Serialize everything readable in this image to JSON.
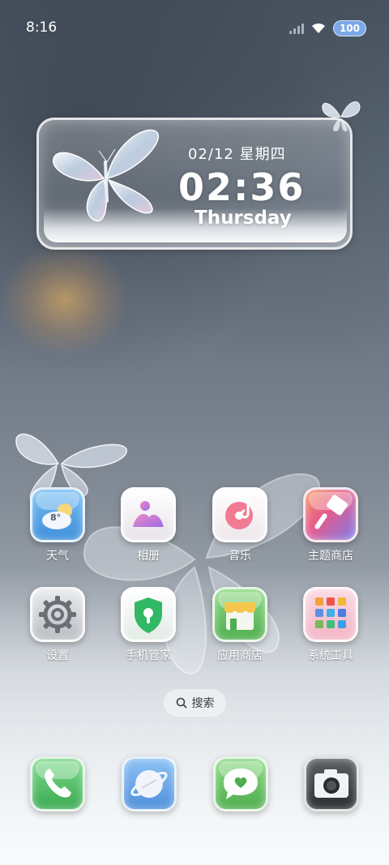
{
  "status_bar": {
    "time": "8:16",
    "battery": "100"
  },
  "widget": {
    "date": "02/12 星期四",
    "clock": "02:36",
    "day": "Thursday"
  },
  "apps": [
    {
      "label": "天气",
      "icon": "weather-icon",
      "temp": "8°",
      "color": "#5aa6e6"
    },
    {
      "label": "相册",
      "icon": "gallery-icon",
      "color": "#f4f2f6"
    },
    {
      "label": "音乐",
      "icon": "music-icon",
      "color": "#f3eef0"
    },
    {
      "label": "主题商店",
      "icon": "theme-store-icon",
      "color": "#e06a8a"
    },
    {
      "label": "设置",
      "icon": "gear-icon",
      "color": "#d3d6d9"
    },
    {
      "label": "手机管家",
      "icon": "security-shield-icon",
      "color": "#eef3ef"
    },
    {
      "label": "应用商店",
      "icon": "app-store-icon",
      "color": "#6cc36a"
    },
    {
      "label": "系统工具",
      "icon": "system-tools-icon",
      "color": "#f6c7d4"
    }
  ],
  "search": {
    "label": "搜索"
  },
  "dock": [
    {
      "icon": "phone-icon",
      "color": "#4cbe5e"
    },
    {
      "icon": "browser-icon",
      "color": "#5b9be3"
    },
    {
      "icon": "messages-icon",
      "color": "#5cc05a"
    },
    {
      "icon": "camera-icon",
      "color": "#3b3d40"
    }
  ]
}
